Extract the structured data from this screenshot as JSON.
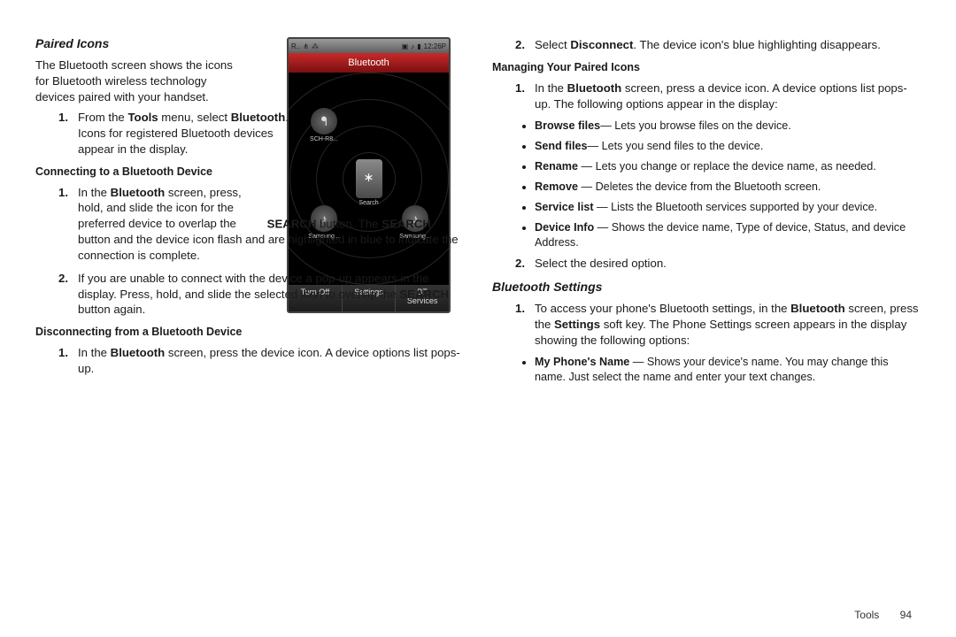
{
  "left": {
    "h_paired": "Paired Icons",
    "intro": "The Bluetooth screen shows the icons for Bluetooth wireless technology devices paired with your handset.",
    "step1a": "From the ",
    "step1b": "Tools",
    "step1c": " menu, select ",
    "step1d": "Bluetooth",
    "step1e": ". Icons for registered Bluetooth devices appear in the display.",
    "h_connect": "Connecting to a Bluetooth Device",
    "c1a": "In the ",
    "c1b": "Bluetooth",
    "c1c": " screen, press, hold, and slide the icon for the preferred device to overlap the ",
    "c1d": "SEARCH",
    "c1e": " button. The ",
    "c1f": "SEARCH",
    "c1g": " button and the device icon flash and are highlighted in blue to indicate the connection is complete.",
    "c2a": "If you are unable to connect with the device a pop-up appears in the display. Press, hold, and slide the selected icon to overlap the ",
    "c2b": "SEARCH",
    "c2c": " button again.",
    "h_disconnect": "Disconnecting from a Bluetooth Device",
    "d1a": "In the ",
    "d1b": "Bluetooth",
    "d1c": " screen, press the device icon. A device options list pops-up."
  },
  "right": {
    "r2a": "Select ",
    "r2b": "Disconnect",
    "r2c": ". The device icon's blue highlighting disappears.",
    "h_manage": "Managing Your Paired Icons",
    "m1a": "In the ",
    "m1b": "Bluetooth",
    "m1c": " screen, press a device icon. A device options list pops-up. The following options appear in the display:",
    "opts": [
      {
        "b": "Browse files",
        "t": "— Lets you browse files on the device."
      },
      {
        "b": "Send files",
        "t": "— Lets you send files to the device."
      },
      {
        "b": "Rename",
        "t": " — Lets you change or replace the device name, as needed."
      },
      {
        "b": "Remove",
        "t": " — Deletes the device from the Bluetooth screen."
      },
      {
        "b": "Service list",
        "t": " — Lists the Bluetooth services supported by your device."
      },
      {
        "b": "Device Info",
        "t": " — Shows the device name, Type of device, Status, and device Address."
      }
    ],
    "m2": "Select the desired option.",
    "h_settings": "Bluetooth Settings",
    "s1a": "To access your phone's Bluetooth settings, in the ",
    "s1b": "Bluetooth",
    "s1c": " screen, press the ",
    "s1d": "Settings",
    "s1e": " soft key. The Phone Settings screen appears in the display showing the following options:",
    "sopt_b": "My Phone's Name",
    "sopt_t": " — Shows your device's name. You may change this name. Just select the name and enter your text changes."
  },
  "fig": {
    "status_left": "R..",
    "status_time": "12:26P",
    "title": "Bluetooth",
    "search_label": "Search",
    "dev1": "SCH-R8...",
    "dev2": "Samsung...",
    "dev3": "Samsung...",
    "soft1": "Turn Off",
    "soft2": "Settings",
    "soft3a": "BT",
    "soft3b": "Services"
  },
  "footer": {
    "section": "Tools",
    "page": "94"
  }
}
